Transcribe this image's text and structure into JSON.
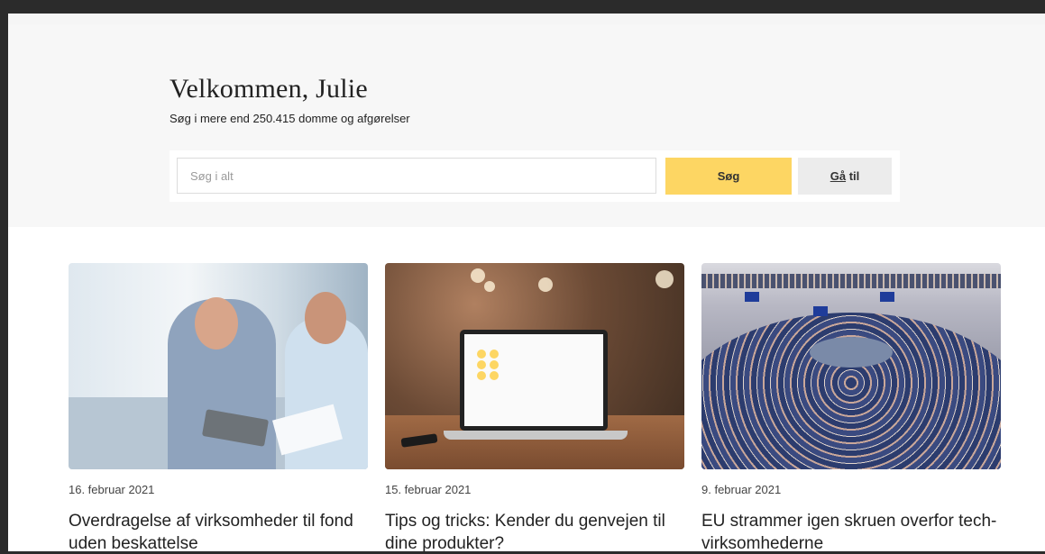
{
  "hero": {
    "welcome": "Velkommen, Julie",
    "subtitle": "Søg i mere end 250.415 domme og afgørelser"
  },
  "search": {
    "placeholder": "Søg i alt",
    "value": "",
    "submit_label": "Søg",
    "goto_label_underlined": "Gå",
    "goto_label_rest": " til"
  },
  "colors": {
    "accent": "#fdd663",
    "hero_bg": "#f7f7f7",
    "goto_bg": "#ececec"
  },
  "articles": [
    {
      "date": "16. februar 2021",
      "title": "Overdragelse af virksomheder til fond uden beskattelse",
      "image": "business-meeting-photo"
    },
    {
      "date": "15. februar 2021",
      "title": "Tips og tricks: Kender du genvejen til dine produkter?",
      "image": "laptop-on-table-photo"
    },
    {
      "date": "9. februar 2021",
      "title": "EU strammer igen skruen overfor tech-virksomhederne",
      "image": "european-parliament-photo"
    }
  ]
}
